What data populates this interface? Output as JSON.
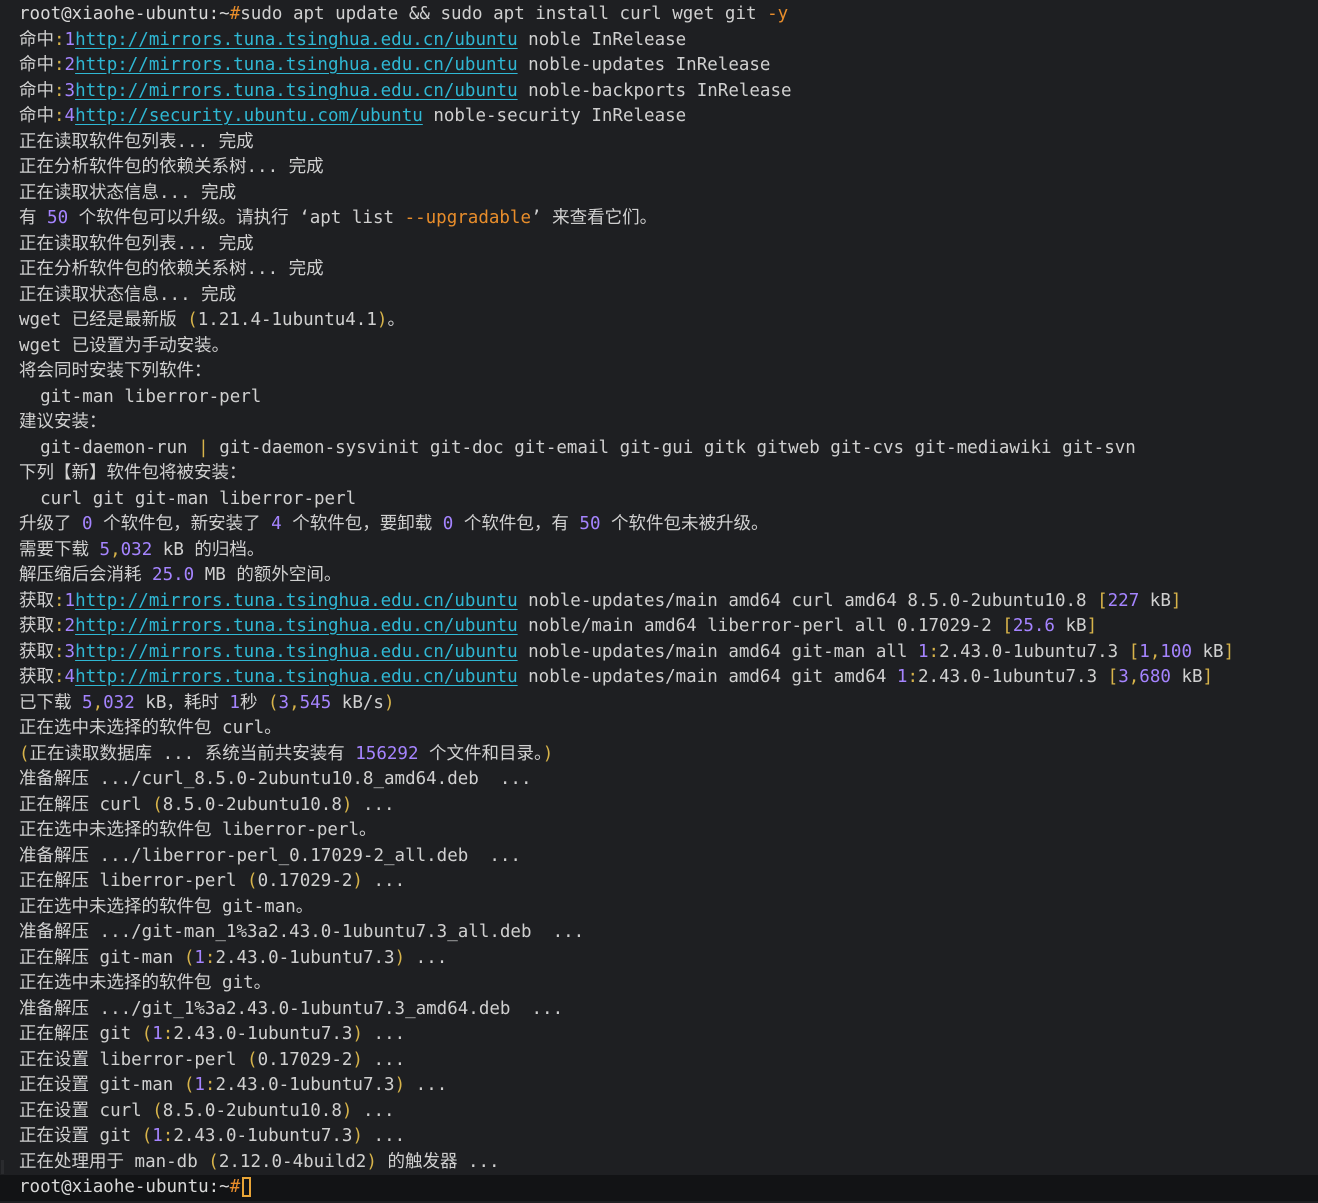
{
  "terminal": {
    "lines": [
      [
        [
          "prm",
          "root@xiaohe-ubuntu:~"
        ],
        [
          "org",
          "#"
        ],
        [
          "",
          "sudo apt update && sudo apt install curl wget git "
        ],
        [
          "org",
          "-y"
        ]
      ],
      [
        [
          "",
          "命中"
        ],
        [
          "yel",
          ":"
        ],
        [
          "num",
          "1"
        ],
        [
          "",
          ""
        ],
        [
          "url",
          "http://mirrors.tuna.tsinghua.edu.cn/ubuntu"
        ],
        [
          "",
          " noble InRelease"
        ]
      ],
      [
        [
          "",
          "命中"
        ],
        [
          "yel",
          ":"
        ],
        [
          "num",
          "2"
        ],
        [
          "",
          ""
        ],
        [
          "url",
          "http://mirrors.tuna.tsinghua.edu.cn/ubuntu"
        ],
        [
          "",
          " noble-updates InRelease"
        ]
      ],
      [
        [
          "",
          "命中"
        ],
        [
          "yel",
          ":"
        ],
        [
          "num",
          "3"
        ],
        [
          "",
          ""
        ],
        [
          "url",
          "http://mirrors.tuna.tsinghua.edu.cn/ubuntu"
        ],
        [
          "",
          " noble-backports InRelease"
        ]
      ],
      [
        [
          "",
          "命中"
        ],
        [
          "yel",
          ":"
        ],
        [
          "num",
          "4"
        ],
        [
          "",
          ""
        ],
        [
          "url",
          "http://security.ubuntu.com/ubuntu"
        ],
        [
          "",
          " noble-security InRelease"
        ]
      ],
      [
        [
          "",
          "正在读取软件包列表... 完成"
        ]
      ],
      [
        [
          "",
          "正在分析软件包的依赖关系树... 完成"
        ]
      ],
      [
        [
          "",
          "正在读取状态信息... 完成"
        ]
      ],
      [
        [
          "",
          "有 "
        ],
        [
          "num",
          "50"
        ],
        [
          "",
          " 个软件包可以升级。请执行 ‘apt list "
        ],
        [
          "org",
          "--upgradable"
        ],
        [
          "",
          "’ 来查看它们。"
        ]
      ],
      [
        [
          "",
          "正在读取软件包列表... 完成"
        ]
      ],
      [
        [
          "",
          "正在分析软件包的依赖关系树... 完成"
        ]
      ],
      [
        [
          "",
          "正在读取状态信息... 完成"
        ]
      ],
      [
        [
          "",
          "wget 已经是最新版 "
        ],
        [
          "yel",
          "("
        ],
        [
          "",
          "1.21.4-1ubuntu4.1"
        ],
        [
          "yel",
          ")"
        ],
        [
          "",
          "。"
        ]
      ],
      [
        [
          "",
          "wget 已设置为手动安装。"
        ]
      ],
      [
        [
          "",
          "将会同时安装下列软件："
        ]
      ],
      [
        [
          "",
          "  git-man liberror-perl"
        ]
      ],
      [
        [
          "",
          "建议安装："
        ]
      ],
      [
        [
          "",
          "  git-daemon-run "
        ],
        [
          "yel",
          "|"
        ],
        [
          "",
          " git-daemon-sysvinit git-doc git-email git-gui gitk gitweb git-cvs git-mediawiki git-svn"
        ]
      ],
      [
        [
          "",
          "下列【新】软件包将被安装："
        ]
      ],
      [
        [
          "",
          "  curl git git-man liberror-perl"
        ]
      ],
      [
        [
          "",
          "升级了 "
        ],
        [
          "num",
          "0"
        ],
        [
          "",
          " 个软件包，新安装了 "
        ],
        [
          "num",
          "4"
        ],
        [
          "",
          " 个软件包，要卸载 "
        ],
        [
          "num",
          "0"
        ],
        [
          "",
          " 个软件包，有 "
        ],
        [
          "num",
          "50"
        ],
        [
          "",
          " 个软件包未被升级。"
        ]
      ],
      [
        [
          "",
          "需要下载 "
        ],
        [
          "num",
          "5"
        ],
        [
          "yel",
          ","
        ],
        [
          "num",
          "032"
        ],
        [
          "",
          " kB 的归档。"
        ]
      ],
      [
        [
          "",
          "解压缩后会消耗 "
        ],
        [
          "num",
          "25.0"
        ],
        [
          "",
          " MB 的额外空间。"
        ]
      ],
      [
        [
          "",
          "获取"
        ],
        [
          "yel",
          ":"
        ],
        [
          "num",
          "1"
        ],
        [
          "",
          ""
        ],
        [
          "url",
          "http://mirrors.tuna.tsinghua.edu.cn/ubuntu"
        ],
        [
          "",
          " noble-updates/main amd64 curl amd64 8.5.0-2ubuntu10.8 "
        ],
        [
          "yel",
          "["
        ],
        [
          "num",
          "227"
        ],
        [
          "",
          " kB"
        ],
        [
          "yel",
          "]"
        ]
      ],
      [
        [
          "",
          "获取"
        ],
        [
          "yel",
          ":"
        ],
        [
          "num",
          "2"
        ],
        [
          "",
          ""
        ],
        [
          "url",
          "http://mirrors.tuna.tsinghua.edu.cn/ubuntu"
        ],
        [
          "",
          " noble/main amd64 liberror-perl all 0.17029-2 "
        ],
        [
          "yel",
          "["
        ],
        [
          "num",
          "25.6"
        ],
        [
          "",
          " kB"
        ],
        [
          "yel",
          "]"
        ]
      ],
      [
        [
          "",
          "获取"
        ],
        [
          "yel",
          ":"
        ],
        [
          "num",
          "3"
        ],
        [
          "",
          ""
        ],
        [
          "url",
          "http://mirrors.tuna.tsinghua.edu.cn/ubuntu"
        ],
        [
          "",
          " noble-updates/main amd64 git-man all "
        ],
        [
          "num",
          "1"
        ],
        [
          "yel",
          ":"
        ],
        [
          "",
          "2.43.0-1ubuntu7.3 "
        ],
        [
          "yel",
          "["
        ],
        [
          "num",
          "1"
        ],
        [
          "yel",
          ","
        ],
        [
          "num",
          "100"
        ],
        [
          "",
          " kB"
        ],
        [
          "yel",
          "]"
        ]
      ],
      [
        [
          "",
          "获取"
        ],
        [
          "yel",
          ":"
        ],
        [
          "num",
          "4"
        ],
        [
          "",
          ""
        ],
        [
          "url",
          "http://mirrors.tuna.tsinghua.edu.cn/ubuntu"
        ],
        [
          "",
          " noble-updates/main amd64 git amd64 "
        ],
        [
          "num",
          "1"
        ],
        [
          "yel",
          ":"
        ],
        [
          "",
          "2.43.0-1ubuntu7.3 "
        ],
        [
          "yel",
          "["
        ],
        [
          "num",
          "3"
        ],
        [
          "yel",
          ","
        ],
        [
          "num",
          "680"
        ],
        [
          "",
          " kB"
        ],
        [
          "yel",
          "]"
        ]
      ],
      [
        [
          "",
          "已下载 "
        ],
        [
          "num",
          "5"
        ],
        [
          "yel",
          ","
        ],
        [
          "num",
          "032"
        ],
        [
          "",
          " kB，耗时 "
        ],
        [
          "num",
          "1"
        ],
        [
          "",
          "秒 "
        ],
        [
          "yel",
          "("
        ],
        [
          "num",
          "3"
        ],
        [
          "yel",
          ","
        ],
        [
          "num",
          "545"
        ],
        [
          "",
          " kB/s"
        ],
        [
          "yel",
          ")"
        ]
      ],
      [
        [
          "",
          "正在选中未选择的软件包 curl。"
        ]
      ],
      [
        [
          "yel",
          "("
        ],
        [
          "",
          "正在读取数据库 ... 系统当前共安装有 "
        ],
        [
          "num",
          "156292"
        ],
        [
          "",
          " 个文件和目录。"
        ],
        [
          "yel",
          ")"
        ]
      ],
      [
        [
          "",
          "准备解压 .../curl_8.5.0-2ubuntu10.8_amd64.deb  ..."
        ]
      ],
      [
        [
          "",
          "正在解压 curl "
        ],
        [
          "yel",
          "("
        ],
        [
          "",
          "8.5.0-2ubuntu10.8"
        ],
        [
          "yel",
          ")"
        ],
        [
          "",
          " ..."
        ]
      ],
      [
        [
          "",
          "正在选中未选择的软件包 liberror-perl。"
        ]
      ],
      [
        [
          "",
          "准备解压 .../liberror-perl_0.17029-2_all.deb  ..."
        ]
      ],
      [
        [
          "",
          "正在解压 liberror-perl "
        ],
        [
          "yel",
          "("
        ],
        [
          "",
          "0.17029-2"
        ],
        [
          "yel",
          ")"
        ],
        [
          "",
          " ..."
        ]
      ],
      [
        [
          "",
          "正在选中未选择的软件包 git-man。"
        ]
      ],
      [
        [
          "",
          "准备解压 .../git-man_1%3a2.43.0-1ubuntu7.3_all.deb  ..."
        ]
      ],
      [
        [
          "",
          "正在解压 git-man "
        ],
        [
          "yel",
          "("
        ],
        [
          "num",
          "1"
        ],
        [
          "yel",
          ":"
        ],
        [
          "",
          "2.43.0-1ubuntu7.3"
        ],
        [
          "yel",
          ")"
        ],
        [
          "",
          " ..."
        ]
      ],
      [
        [
          "",
          "正在选中未选择的软件包 git。"
        ]
      ],
      [
        [
          "",
          "准备解压 .../git_1%3a2.43.0-1ubuntu7.3_amd64.deb  ..."
        ]
      ],
      [
        [
          "",
          "正在解压 git "
        ],
        [
          "yel",
          "("
        ],
        [
          "num",
          "1"
        ],
        [
          "yel",
          ":"
        ],
        [
          "",
          "2.43.0-1ubuntu7.3"
        ],
        [
          "yel",
          ")"
        ],
        [
          "",
          " ..."
        ]
      ],
      [
        [
          "",
          "正在设置 liberror-perl "
        ],
        [
          "yel",
          "("
        ],
        [
          "",
          "0.17029-2"
        ],
        [
          "yel",
          ")"
        ],
        [
          "",
          " ..."
        ]
      ],
      [
        [
          "",
          "正在设置 git-man "
        ],
        [
          "yel",
          "("
        ],
        [
          "num",
          "1"
        ],
        [
          "yel",
          ":"
        ],
        [
          "",
          "2.43.0-1ubuntu7.3"
        ],
        [
          "yel",
          ")"
        ],
        [
          "",
          " ..."
        ]
      ],
      [
        [
          "",
          "正在设置 curl "
        ],
        [
          "yel",
          "("
        ],
        [
          "",
          "8.5.0-2ubuntu10.8"
        ],
        [
          "yel",
          ")"
        ],
        [
          "",
          " ..."
        ]
      ],
      [
        [
          "",
          "正在设置 git "
        ],
        [
          "yel",
          "("
        ],
        [
          "num",
          "1"
        ],
        [
          "yel",
          ":"
        ],
        [
          "",
          "2.43.0-1ubuntu7.3"
        ],
        [
          "yel",
          ")"
        ],
        [
          "",
          " ..."
        ]
      ],
      [
        [
          "",
          "正在处理用于 man-db "
        ],
        [
          "yel",
          "("
        ],
        [
          "",
          "2.12.0-4build2"
        ],
        [
          "yel",
          ")"
        ],
        [
          "",
          " 的触发器 ..."
        ]
      ],
      [
        [
          "prm",
          "root@xiaohe-ubuntu:~"
        ],
        [
          "org",
          "#"
        ],
        [
          "",
          ""
        ]
      ]
    ]
  },
  "colors": {
    "background": "#1e1f22",
    "text": "#d0d0d0",
    "url": "#2fb8d4",
    "number": "#a584ff",
    "punct": "#d7b34a",
    "flag": "#e88d2b",
    "cursor": "#e8a436"
  }
}
